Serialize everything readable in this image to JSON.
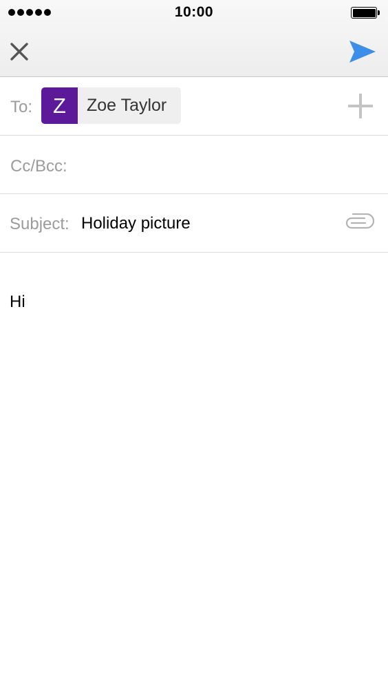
{
  "status_bar": {
    "time": "10:00",
    "signal_bars": 5,
    "battery_level": 1.0
  },
  "nav": {
    "close_icon": "close-icon",
    "send_icon": "send-icon",
    "send_color": "#3d8ee8"
  },
  "to": {
    "label": "To:",
    "recipient": {
      "initial": "Z",
      "name": "Zoe Taylor",
      "avatar_color": "#5c1a9a"
    },
    "add_icon": "plus-icon"
  },
  "cc": {
    "label": "Cc/Bcc:",
    "value": ""
  },
  "subject": {
    "label": "Subject:",
    "value": "Holiday picture",
    "attach_icon": "paperclip-icon"
  },
  "body": {
    "text": "Hi"
  }
}
